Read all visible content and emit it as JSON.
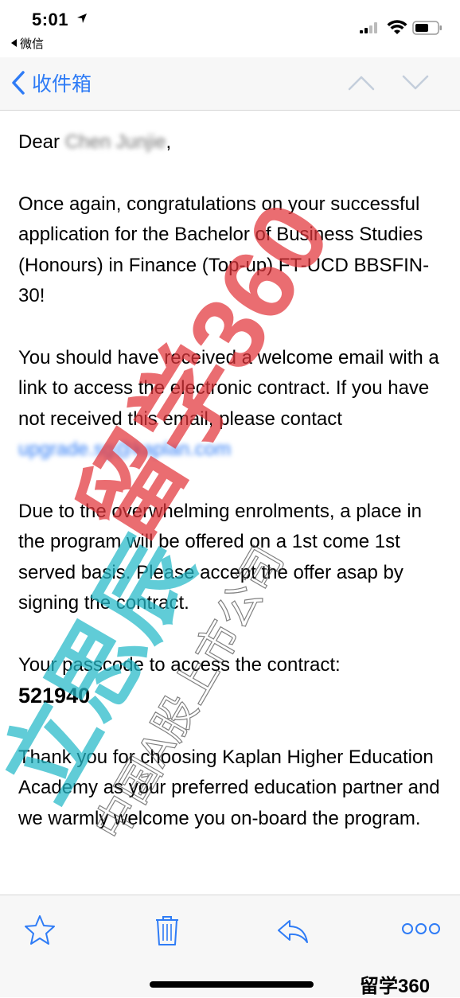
{
  "status_bar": {
    "time": "5:01",
    "back_app": "微信"
  },
  "nav": {
    "back_label": "收件箱"
  },
  "email": {
    "greeting_prefix": "Dear ",
    "recipient_name": "Chen Junjie",
    "greeting_suffix": ",",
    "paragraph1": "Once again, congratulations on your successful application for the Bachelor of Business Studies (Honours) in Finance (Top-up) FT-UCD BBSFIN-30!",
    "paragraph2_text": "You should have received a welcome email with a link to access the electronic contract. If you have not received this email, please contact ",
    "contact_link": "upgrade.sg@kaplan.com",
    "paragraph3": "Due to the overwhelming enrolments, a place in the program will be offered on a 1st come 1st served basis. Please accept the offer asap by signing the contract.",
    "passcode_label": "Your passcode to access the contract:",
    "passcode": "521940",
    "paragraph5": "Thank you for choosing Kaplan Higher Education Academy as your preferred education partner and we warmly welcome you on-board the program."
  },
  "watermarks": {
    "red_text": "留学360",
    "cyan_text": "立思辰",
    "gray_text": "中国A股上市公司"
  },
  "toolbar": {
    "corner_logo": "留学360"
  },
  "colors": {
    "accent": "#2f7cf6",
    "watermark_red": "#e2353a",
    "watermark_cyan": "#22b8c8"
  }
}
